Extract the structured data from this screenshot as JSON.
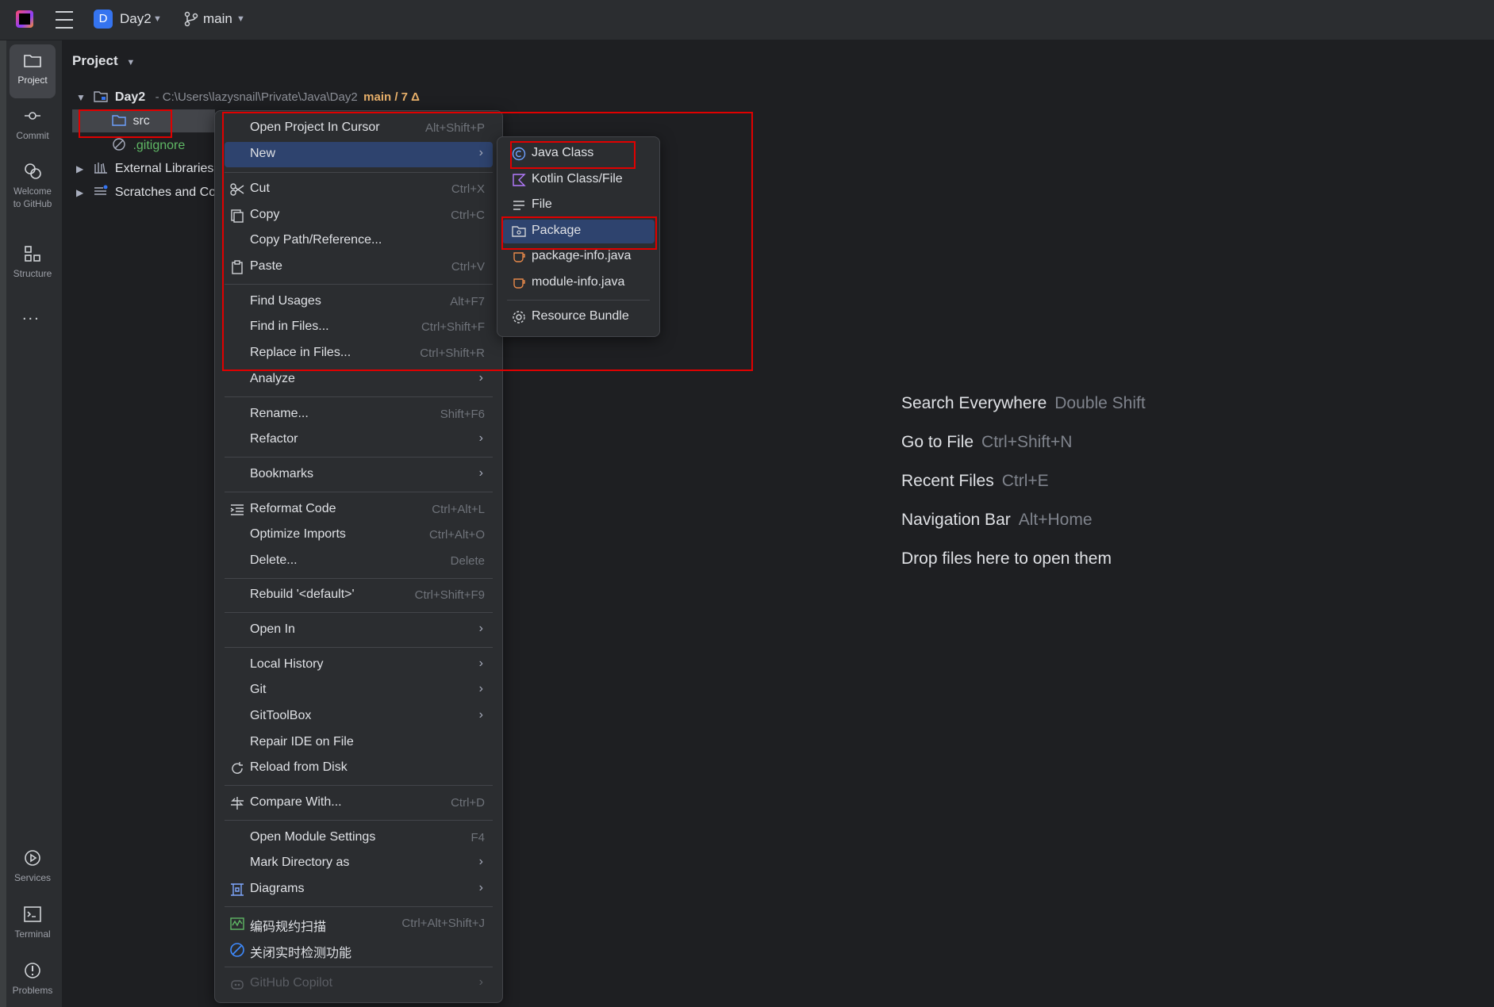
{
  "titlebar": {
    "project_badge": "D",
    "project_name": "Day2",
    "branch": "main"
  },
  "left_toolbar": {
    "project": "Project",
    "commit": "Commit",
    "welcome": "Welcome to GitHub",
    "structure": "Structure",
    "services": "Services",
    "terminal": "Terminal",
    "problems": "Problems",
    "more": "..."
  },
  "project_panel": {
    "title": "Project",
    "root": {
      "name": "Day2",
      "path": "C:\\Users\\lazysnail\\Private\\Java\\Day2",
      "branch": "main / 7 Δ"
    },
    "items": [
      "src",
      ".gitignore",
      "External Libraries",
      "Scratches and Consoles"
    ]
  },
  "context_menu": {
    "open_project_cursor": {
      "label": "Open Project In Cursor",
      "shortcut": "Alt+Shift+P"
    },
    "new": {
      "label": "New"
    },
    "cut": {
      "label": "Cut",
      "shortcut": "Ctrl+X"
    },
    "copy": {
      "label": "Copy",
      "shortcut": "Ctrl+C"
    },
    "copy_path": {
      "label": "Copy Path/Reference..."
    },
    "paste": {
      "label": "Paste",
      "shortcut": "Ctrl+V"
    },
    "find_usages": {
      "label": "Find Usages",
      "shortcut": "Alt+F7"
    },
    "find_in_files": {
      "label": "Find in Files...",
      "shortcut": "Ctrl+Shift+F"
    },
    "replace_in_files": {
      "label": "Replace in Files...",
      "shortcut": "Ctrl+Shift+R"
    },
    "analyze": {
      "label": "Analyze"
    },
    "rename": {
      "label": "Rename...",
      "shortcut": "Shift+F6"
    },
    "refactor": {
      "label": "Refactor"
    },
    "bookmarks": {
      "label": "Bookmarks"
    },
    "reformat": {
      "label": "Reformat Code",
      "shortcut": "Ctrl+Alt+L"
    },
    "optimize_imports": {
      "label": "Optimize Imports",
      "shortcut": "Ctrl+Alt+O"
    },
    "delete": {
      "label": "Delete...",
      "shortcut": "Delete"
    },
    "rebuild": {
      "label": "Rebuild '<default>'",
      "shortcut": "Ctrl+Shift+F9"
    },
    "open_in": {
      "label": "Open In"
    },
    "local_history": {
      "label": "Local History"
    },
    "git": {
      "label": "Git"
    },
    "gittoolbox": {
      "label": "GitToolBox"
    },
    "repair_ide": {
      "label": "Repair IDE on File"
    },
    "reload": {
      "label": "Reload from Disk"
    },
    "compare": {
      "label": "Compare With...",
      "shortcut": "Ctrl+D"
    },
    "module_settings": {
      "label": "Open Module Settings",
      "shortcut": "F4"
    },
    "mark_dir": {
      "label": "Mark Directory as"
    },
    "diagrams": {
      "label": "Diagrams"
    },
    "code_scan": {
      "label": "编码规约扫描",
      "shortcut": "Ctrl+Alt+Shift+J"
    },
    "close_realtime": {
      "label": "关闭实时检测功能"
    },
    "copilot": {
      "label": "GitHub Copilot"
    }
  },
  "new_submenu": {
    "java_class": "Java Class",
    "kotlin": "Kotlin Class/File",
    "file": "File",
    "package": "Package",
    "package_info": "package-info.java",
    "module_info": "module-info.java",
    "resource_bundle": "Resource Bundle"
  },
  "welcome_hints": [
    {
      "action": "Search Everywhere",
      "key": "Double Shift"
    },
    {
      "action": "Go to File",
      "key": "Ctrl+Shift+N"
    },
    {
      "action": "Recent Files",
      "key": "Ctrl+E"
    },
    {
      "action": "Navigation Bar",
      "key": "Alt+Home"
    },
    {
      "action": "Drop files here to open them",
      "key": ""
    }
  ],
  "colors": {
    "background": "#1e1f22",
    "panel": "#2b2d30",
    "highlight": "#2e436e",
    "accent": "#3574f0",
    "annotation": "#e00000"
  }
}
